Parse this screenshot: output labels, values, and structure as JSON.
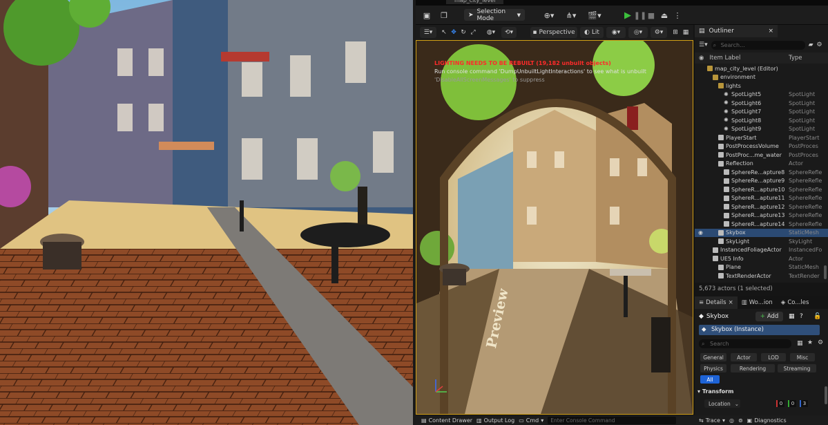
{
  "tab": {
    "level_name": "map_city_level"
  },
  "toolbar": {
    "selection_mode": "Selection Mode"
  },
  "viewport": {
    "perspective": "Perspective",
    "lit": "Lit",
    "warning": "LIGHTING NEEDS TO BE REBUILT (19,182 unbuilt objects)",
    "console_hint": "Run console command 'DumpUnbuiltLightInteractions' to see what is unbuilt",
    "suppress_hint": "'DisableAllScreenMessages' to suppress",
    "preview_label": "Preview"
  },
  "outliner": {
    "tab_label": "Outliner",
    "search_placeholder": "Search...",
    "col_label": "Item Label",
    "col_type": "Type",
    "rows": [
      {
        "label": "map_city_level (Editor)",
        "type": "",
        "indent": 1
      },
      {
        "label": "environment",
        "type": "",
        "indent": 2
      },
      {
        "label": "lights",
        "type": "",
        "indent": 3
      },
      {
        "label": "SpotLight5",
        "type": "SpotLight",
        "indent": 4
      },
      {
        "label": "SpotLight6",
        "type": "SpotLight",
        "indent": 4
      },
      {
        "label": "SpotLight7",
        "type": "SpotLight",
        "indent": 4
      },
      {
        "label": "SpotLight8",
        "type": "SpotLight",
        "indent": 4
      },
      {
        "label": "SpotLight9",
        "type": "SpotLight",
        "indent": 4
      },
      {
        "label": "PlayerStart",
        "type": "PlayerStart",
        "indent": 3
      },
      {
        "label": "PostProcessVolume",
        "type": "PostProces",
        "indent": 3
      },
      {
        "label": "PostProc...me_water",
        "type": "PostProces",
        "indent": 3
      },
      {
        "label": "Reflection",
        "type": "Actor",
        "indent": 3
      },
      {
        "label": "SphereRe...apture8",
        "type": "SphereRefle",
        "indent": 4
      },
      {
        "label": "SphereRe...apture9",
        "type": "SphereRefle",
        "indent": 4
      },
      {
        "label": "SphereR...apture10",
        "type": "SphereRefle",
        "indent": 4
      },
      {
        "label": "SphereR...apture11",
        "type": "SphereRefle",
        "indent": 4
      },
      {
        "label": "SphereR...apture12",
        "type": "SphereRefle",
        "indent": 4
      },
      {
        "label": "SphereR...apture13",
        "type": "SphereRefle",
        "indent": 4
      },
      {
        "label": "SphereR...apture14",
        "type": "SphereRefle",
        "indent": 4
      },
      {
        "label": "Skybox",
        "type": "StaticMesh",
        "indent": 3,
        "selected": true
      },
      {
        "label": "SkyLight",
        "type": "SkyLight",
        "indent": 3
      },
      {
        "label": "InstancedFoliageActor",
        "type": "InstancedFo",
        "indent": 2
      },
      {
        "label": "UE5 Info",
        "type": "Actor",
        "indent": 2
      },
      {
        "label": "Plane",
        "type": "StaticMesh",
        "indent": 3
      },
      {
        "label": "TextRenderActor",
        "type": "TextRender",
        "indent": 3
      }
    ],
    "status": "5,673 actors (1 selected)"
  },
  "details": {
    "tabs": [
      "Details",
      "Wo...ion",
      "Co...les"
    ],
    "object_name": "Skybox",
    "add_label": "Add",
    "instance": "Skybox (Instance)",
    "search_placeholder": "Search",
    "filters": [
      "General",
      "Actor",
      "LOD",
      "Misc",
      "Physics",
      "Rendering",
      "Streaming",
      "All"
    ],
    "section": "Transform",
    "location_label": "Location",
    "loc_x": "0",
    "loc_y": "0",
    "loc_z": "3"
  },
  "bottom": {
    "content_drawer": "Content Drawer",
    "output_log": "Output Log",
    "cmd": "Cmd",
    "console_placeholder": "Enter Console Command",
    "trace": "Trace",
    "diagnostics": "Diagnostics"
  },
  "colors": {
    "viewport_border": "#d2a016",
    "selection": "#2b4a73",
    "warning": "#ff2a2a",
    "play_green": "#3cbf3c",
    "filter_active": "#1e63d6"
  }
}
